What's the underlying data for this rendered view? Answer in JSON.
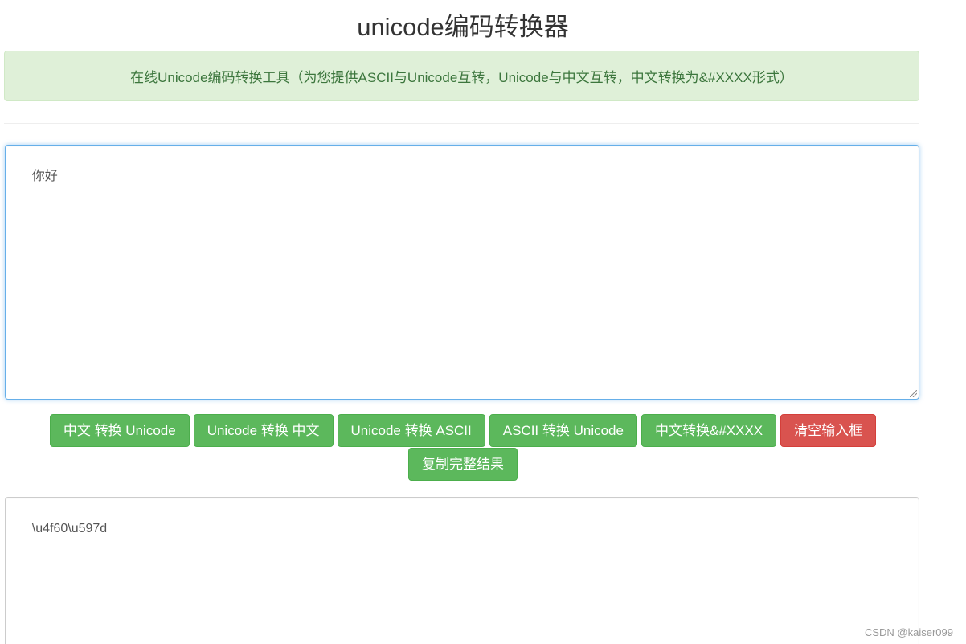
{
  "page": {
    "title": "unicode编码转换器",
    "intro": "在线Unicode编码转换工具（为您提供ASCII与Unicode互转，Unicode与中文互转，中文转换为&#XXXX形式）"
  },
  "input": {
    "value": "你好"
  },
  "buttons": {
    "zh_to_unicode": "中文 转换 Unicode",
    "unicode_to_zh": "Unicode 转换 中文",
    "unicode_to_ascii": "Unicode 转换 ASCII",
    "ascii_to_unicode": "ASCII 转换 Unicode",
    "zh_to_entity": "中文转换&#XXXX",
    "clear": "清空输入框",
    "copy": "复制完整结果"
  },
  "output": {
    "value": "\\u4f60\\u597d"
  },
  "watermark": "CSDN @kaiser099",
  "colors": {
    "success": "#5cb85c",
    "danger": "#d9534f",
    "alert_bg": "#dff0d8",
    "alert_text": "#3c763d",
    "focus_border": "#66afe9"
  }
}
